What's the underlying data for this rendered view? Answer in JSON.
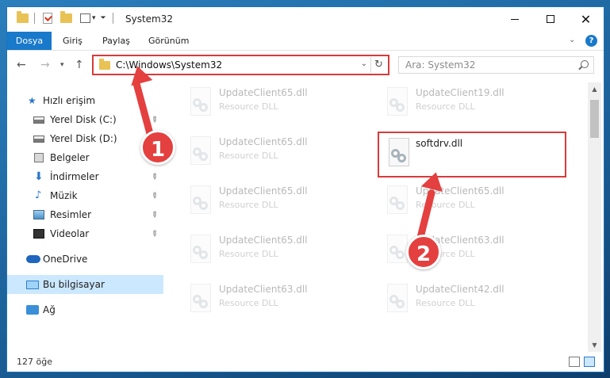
{
  "window": {
    "title": "System32",
    "controls": {
      "minimize": "minimize",
      "maximize": "maximize",
      "close": "✕"
    }
  },
  "ribbon": {
    "tabs": [
      {
        "label": "Dosya"
      },
      {
        "label": "Giriş"
      },
      {
        "label": "Paylaş"
      },
      {
        "label": "Görünüm"
      }
    ],
    "help": "?"
  },
  "address": {
    "path": "C:\\Windows\\System32",
    "search_placeholder": "Ara: System32"
  },
  "sidebar": {
    "items": [
      {
        "label": "Hızlı erişim",
        "icon": "star-icon",
        "pinned": false
      },
      {
        "label": "Yerel Disk (C:)",
        "icon": "drive-icon",
        "pinned": true
      },
      {
        "label": "Yerel Disk (D:)",
        "icon": "drive-icon",
        "pinned": false
      },
      {
        "label": "Belgeler",
        "icon": "documents-icon",
        "pinned": true
      },
      {
        "label": "İndirmeler",
        "icon": "download-icon",
        "pinned": true
      },
      {
        "label": "Müzik",
        "icon": "music-icon",
        "pinned": true
      },
      {
        "label": "Resimler",
        "icon": "pictures-icon",
        "pinned": true
      },
      {
        "label": "Videolar",
        "icon": "videos-icon",
        "pinned": true
      },
      {
        "label": "OneDrive",
        "icon": "onedrive-icon",
        "pinned": false
      },
      {
        "label": "Bu bilgisayar",
        "icon": "computer-icon",
        "pinned": false,
        "selected": true
      },
      {
        "label": "Ağ",
        "icon": "network-icon",
        "pinned": false
      }
    ]
  },
  "files": [
    {
      "name": "UpdateClient65.dll",
      "type": "Resource DLL"
    },
    {
      "name": "UpdateClient19.dll",
      "type": "Resource DLL"
    },
    {
      "name": "UpdateClient65.dll",
      "type": "Resource DLL"
    },
    {
      "name": "softdrv.dll",
      "type": ""
    },
    {
      "name": "UpdateClient65.dll",
      "type": "Resource DLL"
    },
    {
      "name": "UpdateClient65.dll",
      "type": "Resource DLL"
    },
    {
      "name": "UpdateClient65.dll",
      "type": "Resource DLL"
    },
    {
      "name": "UpdateClient63.dll",
      "type": "Resource DLL"
    },
    {
      "name": "UpdateClient63.dll",
      "type": "Resource DLL"
    },
    {
      "name": "UpdateClient42.dll",
      "type": "Resource DLL"
    }
  ],
  "status": {
    "item_count": "127 öğe"
  },
  "annotations": {
    "step1": "1",
    "step2": "2",
    "color": "#e3403f"
  }
}
